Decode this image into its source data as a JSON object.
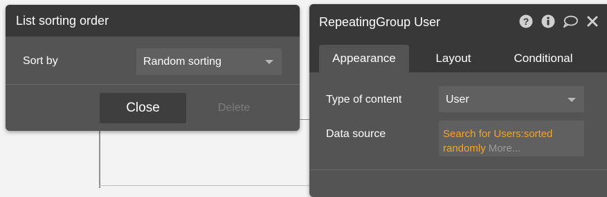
{
  "left_panel": {
    "title": "List sorting order",
    "sort_label": "Sort by",
    "sort_value": "Random sorting",
    "close_label": "Close",
    "delete_label": "Delete"
  },
  "right_panel": {
    "title": "RepeatingGroup User",
    "header_icons": [
      "help-icon",
      "info-icon",
      "comment-icon",
      "close-icon"
    ],
    "tabs": [
      {
        "label": "Appearance",
        "active": true
      },
      {
        "label": "Layout",
        "active": false
      },
      {
        "label": "Conditional",
        "active": false
      }
    ],
    "type_label": "Type of content",
    "type_value": "User",
    "source_label": "Data source",
    "source_line1": "Search for Users:sorted",
    "source_line2": "randomly",
    "source_more": "More..."
  },
  "colors": {
    "panel_bg": "#545454",
    "header_bg": "#383838",
    "input_bg": "#606060",
    "expression_orange": "#f5a623",
    "canvas_bg": "#f3f3f3"
  }
}
